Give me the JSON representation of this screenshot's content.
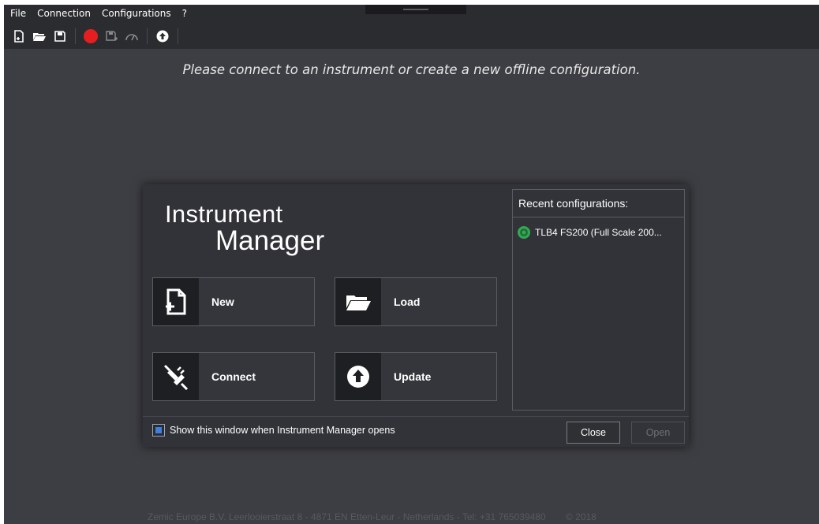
{
  "menu": {
    "items": [
      "File",
      "Connection",
      "Configurations",
      "?"
    ]
  },
  "toolbar": {
    "icons": [
      "new-file-icon",
      "open-folder-icon",
      "save-icon",
      "record-icon",
      "save-device-icon",
      "gauge-icon",
      "upload-icon"
    ],
    "record_color": "#e51f1f"
  },
  "main": {
    "hint": "Please connect to an instrument or create a new offline configuration."
  },
  "dialog": {
    "logo_line1": "Instrument",
    "logo_line2": "Manager",
    "buttons": {
      "new": "New",
      "load": "Load",
      "connect": "Connect",
      "update": "Update"
    },
    "recent": {
      "header": "Recent configurations:",
      "items": [
        "TLB4 FS200 (Full Scale 200..."
      ],
      "item_status_color": "#34a853"
    },
    "show_window_label": "Show this window when Instrument Manager opens",
    "show_window_checked": true,
    "close_label": "Close",
    "open_label": "Open"
  },
  "footer": {
    "address": "Zemic Europe B.V. Leerlooierstraat 8 - 4871 EN Etten-Leur - Netherlands - Tel: +31 765039480",
    "copyright": "© 2018"
  }
}
